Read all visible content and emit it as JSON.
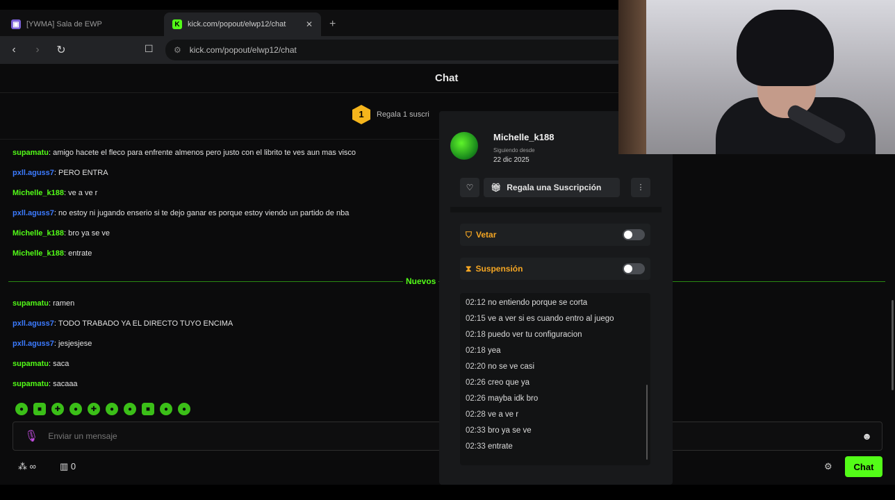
{
  "browser": {
    "tabs": [
      {
        "title": "[YWMA] Sala de EWP",
        "icon": "twitch-favicon"
      },
      {
        "title": "kick.com/popout/elwp12/chat",
        "icon": "kick-favicon"
      }
    ],
    "new_tab": "+",
    "url": "kick.com/popout/elwp12/chat"
  },
  "chat": {
    "header": "Chat",
    "pinned": {
      "badge": "1",
      "text": "Regala 1 suscri"
    },
    "messages": [
      {
        "user": "supamatu",
        "text": ": amigo hacete el fleco para enfrente almenos pero justo con el librito te ves aun mas visco"
      },
      {
        "user": "pxll.aguss7",
        "text": ": PERO ENTRA"
      },
      {
        "user": "Michelle_k188",
        "text": ": ve a ve r"
      },
      {
        "user": "pxll.aguss7",
        "text": ": no estoy ni jugando enserio si te dejo ganar es porque estoy viendo un partido de nba"
      },
      {
        "user": "Michelle_k188",
        "text": ": bro ya se ve"
      },
      {
        "user": "Michelle_k188",
        "text": ": entrate"
      }
    ],
    "new_label": "Nuevos",
    "messages_new": [
      {
        "user": "supamatu",
        "text": ": ramen"
      },
      {
        "user": "pxll.aguss7",
        "text": ": TODO TRABADO YA EL DIRECTO TUYO ENCIMA"
      },
      {
        "user": "pxll.aguss7",
        "text": ": jesjesjese"
      },
      {
        "user": "supamatu",
        "text": ": saca"
      },
      {
        "user": "supamatu",
        "text": ": sacaaa"
      }
    ],
    "input_placeholder": "Enviar un mensaje",
    "points_label": "∞",
    "store_count": "0",
    "send_label": "Chat"
  },
  "user_card": {
    "username": "Michelle_k188",
    "since_label": "Siguiendo desde",
    "since_date": "22 dic 2025",
    "gift_label": "Regala una Suscripción",
    "ban_label": "Vetar",
    "timeout_label": "Suspensión",
    "history": [
      {
        "time": "02:12",
        "text": "no entiendo porque se corta"
      },
      {
        "time": "02:15",
        "text": "ve a ver si es cuando entro al juego"
      },
      {
        "time": "02:18",
        "text": "puedo ver tu configuracion"
      },
      {
        "time": "02:18",
        "text": "yea"
      },
      {
        "time": "02:20",
        "text": "no se ve casi"
      },
      {
        "time": "02:26",
        "text": "creo que ya"
      },
      {
        "time": "02:26",
        "text": "mayba idk bro"
      },
      {
        "time": "02:28",
        "text": "ve a ve r"
      },
      {
        "time": "02:33",
        "text": "bro ya se ve"
      },
      {
        "time": "02:33",
        "text": "entrate"
      }
    ]
  },
  "colors": {
    "kick_green": "#53fc18",
    "link_blue": "#3c7bff",
    "warning": "#f5a623"
  }
}
